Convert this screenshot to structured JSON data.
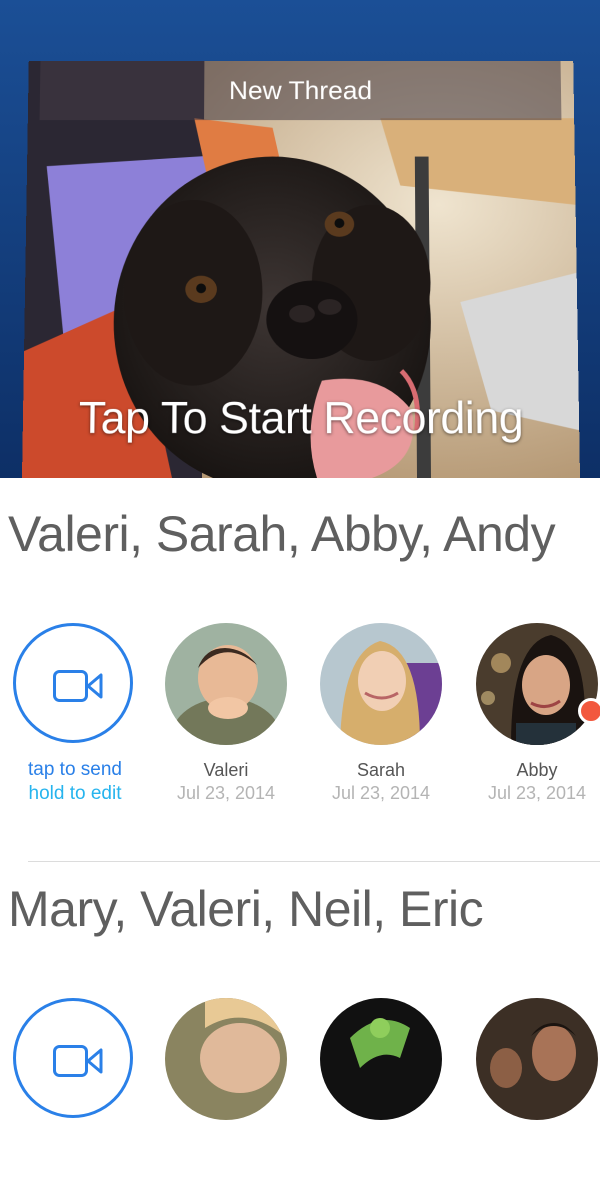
{
  "new_thread": {
    "title": "New Thread",
    "record_prompt": "Tap To Start Recording"
  },
  "threads": [
    {
      "title": "Valeri, Sarah, Abby, Andy",
      "send_label": "tap to send",
      "edit_label": "hold to edit",
      "members": [
        {
          "name": "Valeri",
          "date": "Jul 23, 2014"
        },
        {
          "name": "Sarah",
          "date": "Jul 23, 2014"
        },
        {
          "name": "Abby",
          "date": "Jul 23, 2014",
          "unread": true
        }
      ]
    },
    {
      "title": "Mary, Valeri, Neil, Eric",
      "members": [
        {
          "name": "",
          "date": ""
        },
        {
          "name": "",
          "date": ""
        },
        {
          "name": "",
          "date": ""
        }
      ]
    }
  ],
  "colors": {
    "accent_blue": "#2a80e8",
    "hint_cyan": "#26b4ee",
    "unread_dot": "#f2583e",
    "header_bg": "#1b4f96"
  },
  "icons": {
    "record_button": "video-camera-icon"
  }
}
